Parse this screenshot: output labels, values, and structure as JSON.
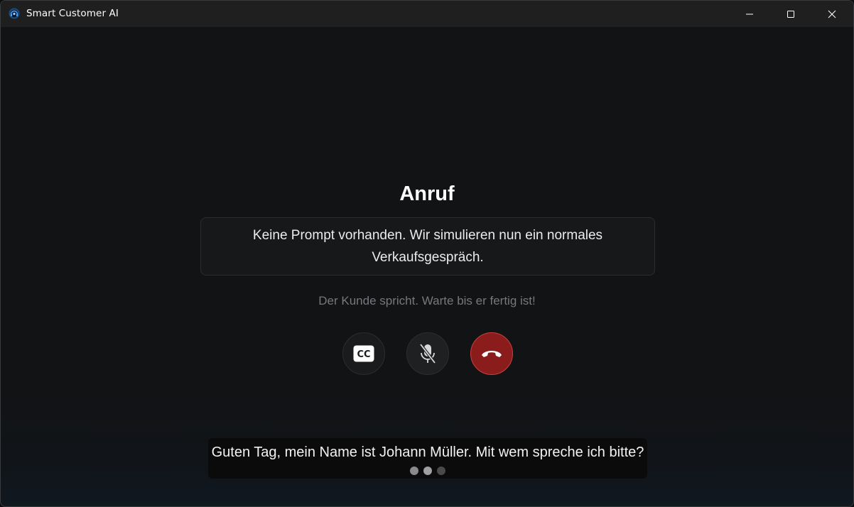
{
  "window": {
    "title": "Smart Customer AI",
    "app_icon": "headset-app-icon",
    "controls": {
      "minimize_icon": "minimize-icon",
      "maximize_icon": "maximize-icon",
      "close_icon": "close-icon"
    }
  },
  "call": {
    "heading": "Anruf",
    "prompt_message": "Keine Prompt vorhanden. Wir simulieren nun ein normales Verkaufsgespräch.",
    "status": "Der Kunde spricht. Warte bis er fertig ist!",
    "controls": [
      {
        "name": "captions",
        "icon": "closed-captions-icon",
        "icon_text": "CC"
      },
      {
        "name": "microphone",
        "icon": "microphone-muted-icon"
      },
      {
        "name": "hang-up",
        "icon": "hang-up-phone-icon",
        "color": "#8a1c1c"
      }
    ]
  },
  "subtitle": {
    "text": "Guten Tag, mein Name ist Johann Müller. Mit wem spreche ich bitte?",
    "typing_indicator_dots": 3
  },
  "colors": {
    "background": "#121315",
    "titlebar": "#1f1f1f",
    "hangup_red": "#8a1c1c",
    "status_gray": "#77787b"
  }
}
